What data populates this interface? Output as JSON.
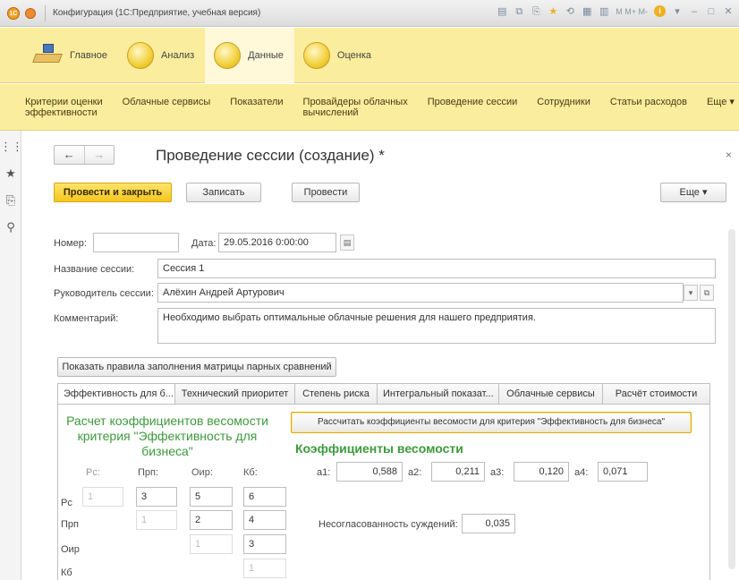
{
  "window": {
    "title": "Конфигурация  (1С:Предприятие, учебная версия)"
  },
  "sections": [
    {
      "label": "Главное"
    },
    {
      "label": "Анализ"
    },
    {
      "label": "Данные"
    },
    {
      "label": "Оценка"
    }
  ],
  "commands": [
    {
      "line1": "Критерии оценки",
      "line2": "эффективности"
    },
    {
      "line1": "Облачные сервисы",
      "line2": ""
    },
    {
      "line1": "Показатели",
      "line2": ""
    },
    {
      "line1": "Провайдеры облачных",
      "line2": "вычислений"
    },
    {
      "line1": "Проведение сессии",
      "line2": ""
    },
    {
      "line1": "Сотрудники",
      "line2": ""
    },
    {
      "line1": "Статьи расходов",
      "line2": ""
    },
    {
      "line1": "Еще ▾",
      "line2": ""
    }
  ],
  "form": {
    "title": "Проведение сессии (создание) *",
    "buttons": {
      "post_close": "Провести и закрыть",
      "save": "Записать",
      "post": "Провести",
      "more": "Еще   ▾"
    },
    "number_label": "Номер:",
    "number_value": "",
    "date_label": "Дата:",
    "date_value": "29.05.2016  0:00:00",
    "session_name_label": "Название сессии:",
    "session_name_value": "Сессия 1",
    "head_label": "Руководитель сессии:",
    "head_value": "Алёхин Андрей Артурович",
    "comment_label": "Комментарий:",
    "comment_value": "Необходимо выбрать оптимальные облачные решения для нашего предприятия.",
    "show_rules_button": "Показать правила заполнения матрицы парных сравнений"
  },
  "tabs": [
    "Эффективность для б...",
    "Технический приоритет",
    "Степень риска",
    "Интегральный показат...",
    "Облачные сервисы",
    "Расчёт стоимости"
  ],
  "panel": {
    "calc_title": "Расчет коэффициентов весомости критерия \"Эффективность для бизнеса\"",
    "calc_button": "Рассчитать коэффициенты весомости для критерия \"Эффективность для бизнеса\"",
    "weights_title": "Коэффициенты весомости",
    "matrix": {
      "col_headers": [
        "Рс:",
        "Прп:",
        "Оир:",
        "Кб:"
      ],
      "row_labels": [
        "Рс",
        "Прп",
        "Оир",
        "Кб"
      ],
      "cells": [
        [
          "1",
          "3",
          "5",
          "6"
        ],
        [
          "",
          "1",
          "2",
          "4"
        ],
        [
          "",
          "",
          "1",
          "3"
        ],
        [
          "",
          "",
          "",
          "1"
        ]
      ]
    },
    "weights": [
      {
        "label": "a1:",
        "value": "0,588"
      },
      {
        "label": "a2:",
        "value": "0,211"
      },
      {
        "label": "a3:",
        "value": "0,120"
      },
      {
        "label": "a4:",
        "value": "0,071"
      }
    ],
    "inconsistency_label": "Несогласованность суждений:",
    "inconsistency_value": "0,035"
  },
  "colors": {
    "sections_bg": "#fbed9e",
    "primary_button": "#f4c61e",
    "green_title": "#3c9a3c"
  }
}
